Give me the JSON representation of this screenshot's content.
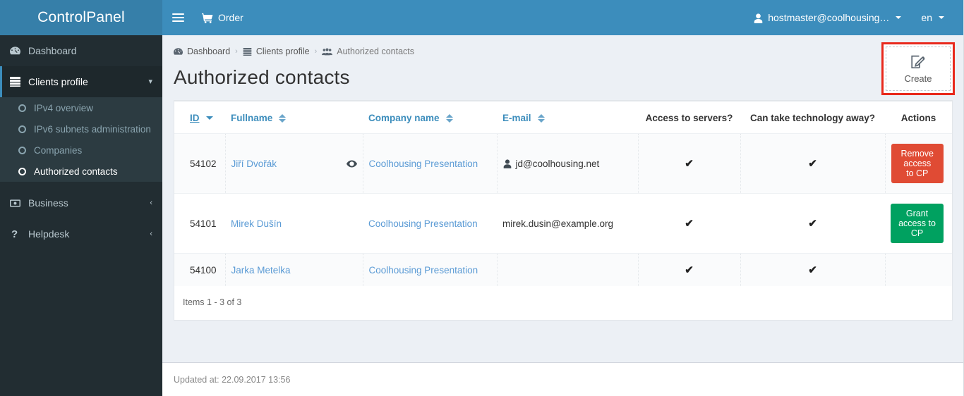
{
  "header": {
    "logo_text": "ControlPanel",
    "menu_toggle_icon": "hamburger-icon",
    "order_label": "Order",
    "order_icon": "shopping-cart-icon",
    "user_label": "hostmaster@coolhousing…",
    "user_icon": "user-icon",
    "lang_label": "en",
    "colors": {
      "logo_bg": "#367fa9",
      "navbar_bg": "#3c8dbc"
    }
  },
  "sidebar": {
    "items": [
      {
        "label": "Dashboard",
        "icon": "dashboard-gauge-icon",
        "active": false
      },
      {
        "label": "Clients profile",
        "icon": "server-stack-icon",
        "active": true,
        "chevron": "chevron-down-icon"
      },
      {
        "label": "Business",
        "icon": "money-bill-icon",
        "active": false,
        "chevron": "chevron-left-icon"
      },
      {
        "label": "Helpdesk",
        "icon": "question-mark-icon",
        "active": false,
        "chevron": "chevron-left-icon"
      }
    ],
    "submenu": [
      {
        "label": "IPv4 overview",
        "current": false
      },
      {
        "label": "IPv6 subnets administration",
        "current": false
      },
      {
        "label": "Companies",
        "current": false
      },
      {
        "label": "Authorized contacts",
        "current": true
      }
    ],
    "colors": {
      "bg": "#222d32",
      "active_bg": "#1e282c",
      "submenu_bg": "#2c3b41",
      "accent": "#3c8dbc"
    }
  },
  "breadcrumb": {
    "items": [
      {
        "label": "Dashboard",
        "icon": "dashboard-gauge-icon",
        "link": true
      },
      {
        "label": "Clients profile",
        "icon": "server-stack-icon",
        "link": true
      },
      {
        "label": "Authorized contacts",
        "icon": "users-group-icon",
        "link": false
      }
    ],
    "separator": "›"
  },
  "page": {
    "title": "Authorized contacts",
    "create_button": {
      "label": "Create",
      "icon": "pencil-square-icon",
      "highlight_color": "#e8291c"
    }
  },
  "table": {
    "columns": [
      {
        "label": "ID",
        "sortable": true,
        "sort_state": "desc",
        "active": true
      },
      {
        "label": "Fullname",
        "sortable": true,
        "sort_state": "none",
        "active": false
      },
      {
        "label": "Company name",
        "sortable": true,
        "sort_state": "none",
        "active": false
      },
      {
        "label": "E-mail",
        "sortable": true,
        "sort_state": "none",
        "active": false
      },
      {
        "label": "Access to servers?",
        "sortable": false,
        "active": false
      },
      {
        "label": "Can take technology away?",
        "sortable": false,
        "active": false
      },
      {
        "label": "Actions",
        "sortable": false,
        "active": false
      }
    ],
    "rows": [
      {
        "id": "54102",
        "fullname": "Jiří Dvořák",
        "has_eye_icon": true,
        "company": "Coolhousing Presentation",
        "email": "jd@coolhousing.net",
        "email_has_user_icon": true,
        "access_to_servers": "✔",
        "can_take_technology_away": "✔",
        "action": {
          "label": "Remove access to CP",
          "style": "danger",
          "color": "#e04b34"
        }
      },
      {
        "id": "54101",
        "fullname": "Mirek Dušín",
        "has_eye_icon": false,
        "company": "Coolhousing Presentation",
        "email": "mirek.dusin@example.org",
        "email_has_user_icon": false,
        "access_to_servers": "✔",
        "can_take_technology_away": "✔",
        "action": {
          "label": "Grant access to CP",
          "style": "success",
          "color": "#00a160"
        }
      },
      {
        "id": "54100",
        "fullname": "Jarka Metelka",
        "has_eye_icon": false,
        "company": "Coolhousing Presentation",
        "email": "",
        "email_has_user_icon": false,
        "access_to_servers": "✔",
        "can_take_technology_away": "✔",
        "action": null
      }
    ],
    "items_summary": "Items 1 - 3 of 3"
  },
  "footer": {
    "updated_at": "Updated at: 22.09.2017 13:56"
  }
}
